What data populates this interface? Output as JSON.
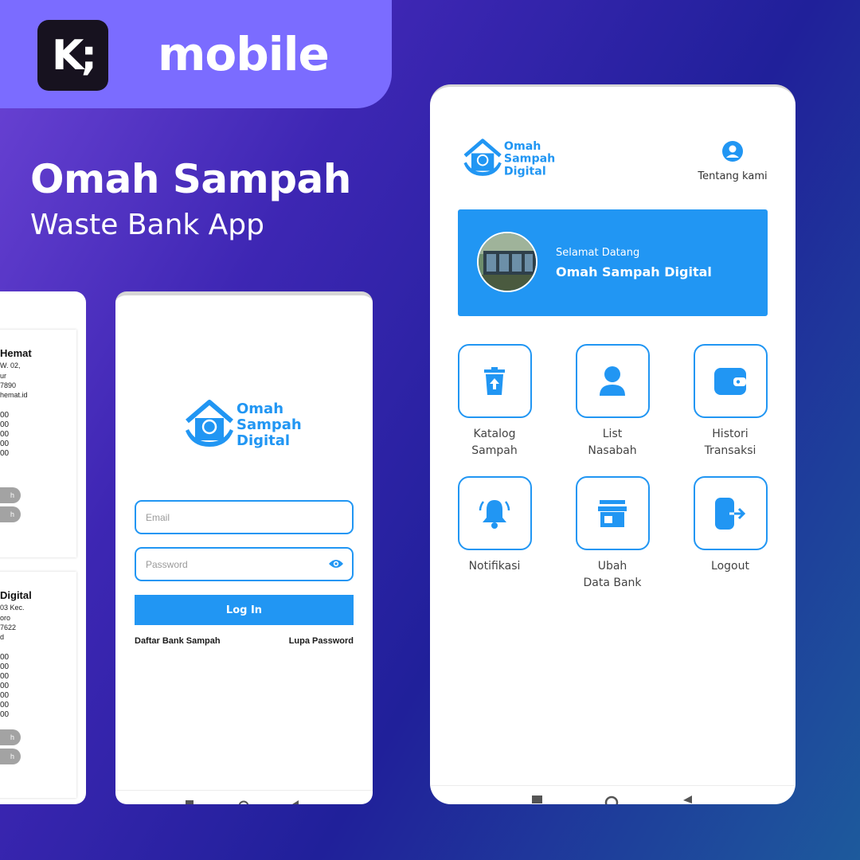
{
  "brand": {
    "logo_text": "K;",
    "wordmark": "mobile"
  },
  "hero": {
    "title": "Omah Sampah",
    "subtitle": "Waste Bank App"
  },
  "app_logo": {
    "line1": "Omah",
    "line2": "Sampah",
    "line3": "Digital"
  },
  "left_screen": {
    "card1": {
      "title": "Hemat",
      "lines": [
        "W. 02,",
        "ur",
        "7890",
        "hemat.id"
      ],
      "numbers": [
        "00",
        "00",
        "00",
        "00",
        "00"
      ],
      "pills": [
        "h",
        "h"
      ]
    },
    "card2": {
      "title": "Digital",
      "lines": [
        "03 Kec.",
        "oro",
        "7622",
        "d"
      ],
      "numbers": [
        "00",
        "00",
        "00",
        "00",
        "00",
        "00",
        "00"
      ],
      "pills": [
        "h",
        "h"
      ]
    }
  },
  "login": {
    "email_placeholder": "Email",
    "password_placeholder": "Password",
    "login_button": "Log In",
    "register_link": "Daftar Bank Sampah",
    "forgot_link": "Lupa Password"
  },
  "main": {
    "about_label": "Tentang kami",
    "welcome_small": "Selamat Datang",
    "welcome_big": "Omah Sampah Digital",
    "tiles": [
      {
        "line1": "Katalog",
        "line2": "Sampah",
        "icon": "trash-upload-icon"
      },
      {
        "line1": "List",
        "line2": "Nasabah",
        "icon": "user-icon"
      },
      {
        "line1": "Histori",
        "line2": "Transaksi",
        "icon": "wallet-icon"
      },
      {
        "line1": "Notifikasi",
        "line2": "",
        "icon": "bell-icon"
      },
      {
        "line1": "Ubah",
        "line2": "Data Bank",
        "icon": "store-icon"
      },
      {
        "line1": "Logout",
        "line2": "",
        "icon": "logout-icon"
      }
    ]
  },
  "colors": {
    "accent": "#2196f3",
    "banner": "#7b6cff",
    "logo_bg": "#17121f"
  }
}
